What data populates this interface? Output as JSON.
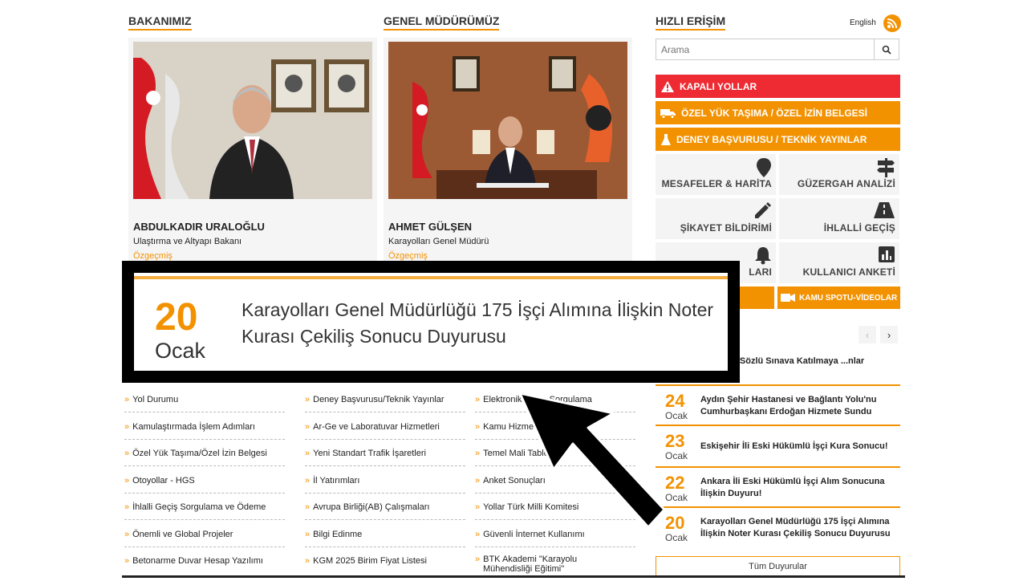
{
  "sections": {
    "minister_title": "BAKANIMIZ",
    "director_title": "GENEL MÜDÜRÜMÜZ",
    "quick_title": "HIZLI ERİŞİM"
  },
  "minister": {
    "name": "ABDULKADIR URALOĞLU",
    "role": "Ulaştırma ve Altyapı Bakanı",
    "bio": "Özgeçmiş"
  },
  "director": {
    "name": "AHMET GÜLŞEN",
    "role": "Karayolları Genel Müdürü",
    "bio": "Özgeçmiş"
  },
  "header": {
    "language": "English"
  },
  "search": {
    "placeholder": "Arama"
  },
  "quick_bars": [
    {
      "label": "KAPALI YOLLAR",
      "color": "#ee2a33",
      "icon": "warning-icon"
    },
    {
      "label": "ÖZEL YÜK TAŞIMA / ÖZEL İZİN BELGESİ",
      "color": "#f39200",
      "icon": "truck-icon"
    },
    {
      "label": "DENEY BAŞVURUSU / TEKNİK YAYINLAR",
      "color": "#f39200",
      "icon": "flask-icon"
    }
  ],
  "tiles": [
    {
      "label": "MESAFELER & HARİTA",
      "icon": "map-pin-icon"
    },
    {
      "label": "GÜZERGAH ANALİZİ",
      "icon": "signpost-icon"
    },
    {
      "label": "ŞİKAYET BİLDİRİMİ",
      "icon": "pencil-icon"
    },
    {
      "label": "İHLALLİ GEÇİŞ",
      "icon": "road-icon"
    },
    {
      "label": "LARI",
      "icon": "bell-icon"
    },
    {
      "label": "KULLANICI ANKETİ",
      "icon": "chart-icon"
    }
  ],
  "video_button": "KAMU SPOTU-VİDEOLAR",
  "links": {
    "col1": [
      "Yol Durumu",
      "Kamulaştırmada İşlem Adımları",
      "Özel Yük Taşıma/Özel İzin Belgesi",
      "Otoyollar - HGS",
      "İhlalli Geçiş Sorgulama ve Ödeme",
      "Önemli ve Global Projeler",
      "Betonarme Duvar Hesap Yazılımı"
    ],
    "col2": [
      "Deney Başvurusu/Teknik Yayınlar",
      "Ar-Ge ve Laboratuvar Hizmetleri",
      "Yeni Standart Trafik İşaretleri",
      "İl Yatırımları",
      "Avrupa Birliği(AB) Çalışmaları",
      "Bilgi Edinme",
      "KGM 2025 Birim Fiyat Listesi"
    ],
    "col3": [
      "Elektronik Belge Sorgulama",
      "Kamu Hizmet Standartları",
      "Temel Mali Tablolar",
      "Anket Sonuçları",
      "Yollar Türk Milli Komitesi",
      "Güvenli İnternet Kullanımı",
      "BTK Akademi \"Karayolu Mühendisliği Eğitimi\""
    ]
  },
  "news": [
    {
      "day": "",
      "month": "",
      "title": "...elli İşçi Sözlü Sınava Katılmaya ...nlar"
    },
    {
      "day": "24",
      "month": "Ocak",
      "title": "Aydın Şehir Hastanesi ve Bağlantı Yolu'nu Cumhurbaşkanı Erdoğan Hizmete Sundu"
    },
    {
      "day": "23",
      "month": "Ocak",
      "title": "Eskişehir İli Eski Hükümlü İşçi Kura Sonucu!"
    },
    {
      "day": "22",
      "month": "Ocak",
      "title": "Ankara İli Eski Hükümlü İşçi Alım Sonucuna İlişkin Duyuru!"
    },
    {
      "day": "20",
      "month": "Ocak",
      "title": "Karayolları Genel Müdürlüğü 175 İşçi Alımına İlişkin Noter Kurası Çekiliş Sonucu Duyurusu"
    }
  ],
  "all_news_button": "Tüm Duyurular",
  "zoom": {
    "day": "20",
    "month": "Ocak",
    "title": "Karayolları Genel Müdürlüğü 175 İşçi Alımına İlişkin Noter Kurası Çekiliş Sonucu Duyurusu"
  },
  "colors": {
    "accent": "#f39200",
    "danger": "#ee2a33"
  }
}
